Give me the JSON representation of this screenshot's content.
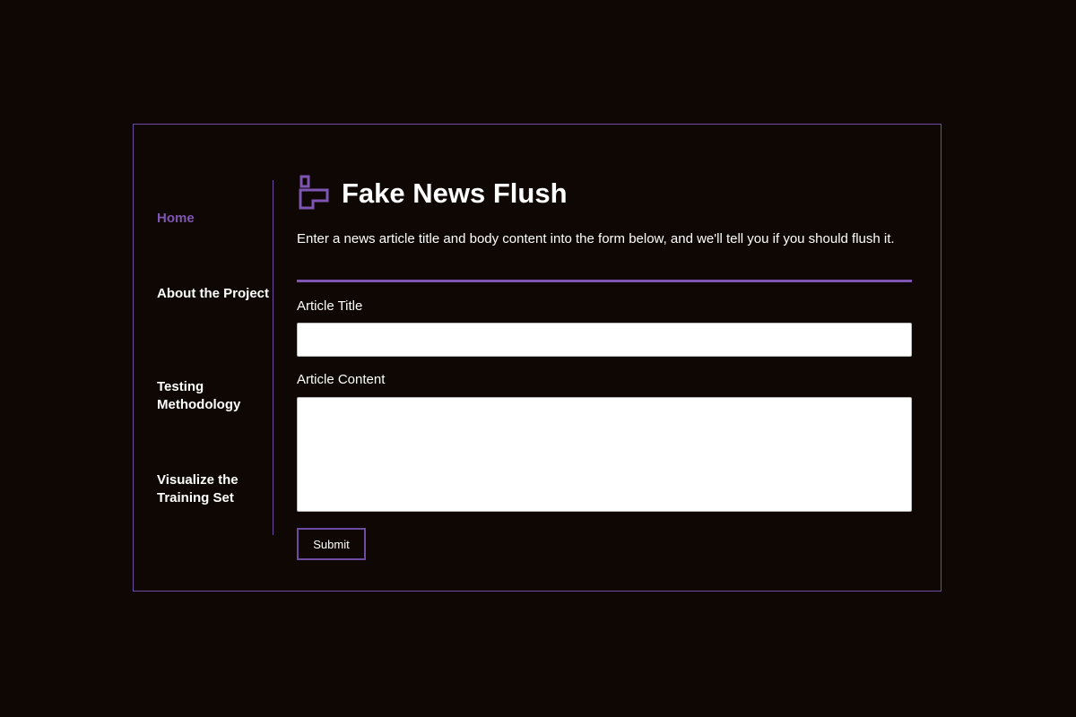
{
  "app": {
    "title": "Fake News Flush",
    "intro": "Enter a news article title and body content into the form below, and we'll tell you if you should flush it.",
    "logo_icon": "toilet-icon"
  },
  "nav": {
    "items": [
      {
        "label": "Home",
        "active": true
      },
      {
        "label": "About the Project",
        "active": false
      },
      {
        "label": "Testing Methodology",
        "active": false
      },
      {
        "label": "Visualize the Training Set",
        "active": false
      }
    ]
  },
  "form": {
    "title_label": "Article Title",
    "title_value": "",
    "content_label": "Article Content",
    "content_value": "",
    "submit_label": "Submit"
  },
  "colors": {
    "accent": "#7e55b3",
    "border": "#6e4ba3",
    "background": "#0f0703",
    "text": "#ffffff"
  }
}
